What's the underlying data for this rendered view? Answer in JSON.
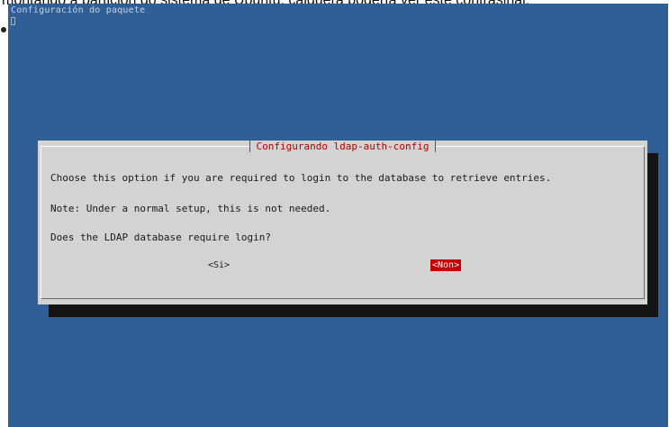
{
  "caption": "montando a partición do sistema de Ubuntu, calquera podería ver este contrasinal.",
  "terminal": {
    "title": "Configuración do paquete"
  },
  "dialog": {
    "title": "Configurando ldap-auth-config",
    "lines": [
      "Choose this option if you are required to login to the database to retrieve entries.",
      "Note: Under a normal setup, this is not needed.",
      "Does the LDAP database require login?"
    ],
    "yes_label": "<Si>",
    "no_label": "<Non>"
  },
  "colors": {
    "terminal_bg": "#2f5f96",
    "dialog_bg": "#d3d3d3",
    "title_fg": "#b30000",
    "selected_bg": "#c40000"
  }
}
